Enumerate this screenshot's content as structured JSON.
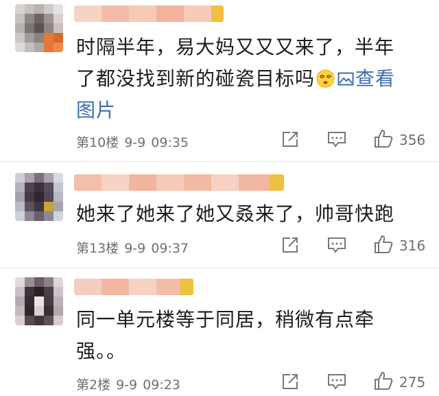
{
  "comments": [
    {
      "text_line1": "时隔半年，易大妈又又又来了，半年",
      "text_line2": "了都没找到新的碰瓷目标吗",
      "link_label": "查看",
      "link_label2": "图片",
      "emoji": "dizzy-face-emoji",
      "floor": "第10楼",
      "date": "9-9",
      "time": "09:35",
      "likes": "356"
    },
    {
      "text_line1": "她来了她来了她又叒来了，帅哥快跑",
      "floor": "第13楼",
      "date": "9-9",
      "time": "09:37",
      "likes": "316"
    },
    {
      "text_line1": "同一单元楼等于同居，稍微有点牵",
      "text_line2": "强。。",
      "floor": "第2楼",
      "date": "9-9",
      "time": "09:23",
      "likes": "275"
    }
  ],
  "icons": {
    "share": "share-icon",
    "reply": "comment-icon",
    "like": "thumbs-up-icon",
    "image": "image-icon"
  },
  "colors": {
    "link": "#3b6fae",
    "meta": "#6f6f6f",
    "name_blur": "#f4b9a4",
    "badge": "#f0c040"
  }
}
